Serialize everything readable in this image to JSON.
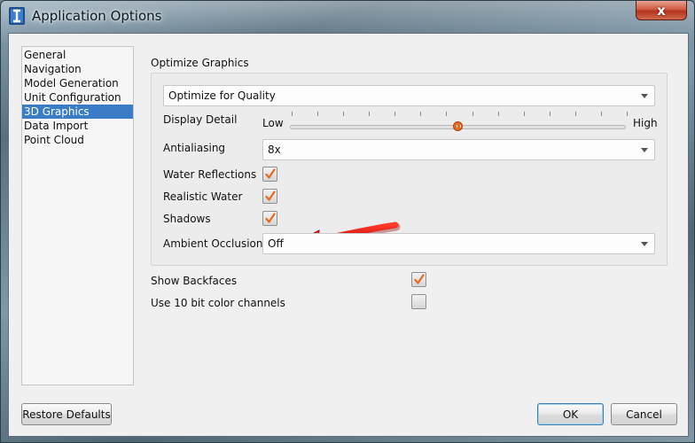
{
  "window": {
    "title": "Application Options",
    "close_glyph": "x"
  },
  "nav": {
    "items": [
      {
        "label": "General",
        "selected": false
      },
      {
        "label": "Navigation",
        "selected": false
      },
      {
        "label": "Model Generation",
        "selected": false
      },
      {
        "label": "Unit Configuration",
        "selected": false
      },
      {
        "label": "3D Graphics",
        "selected": true
      },
      {
        "label": "Data Import",
        "selected": false
      },
      {
        "label": "Point Cloud",
        "selected": false
      }
    ]
  },
  "graphics": {
    "section_label": "Optimize Graphics",
    "optimize_value": "Optimize for Quality",
    "display_detail": {
      "label": "Display Detail",
      "low_label": "Low",
      "high_label": "High",
      "level": 0.5
    },
    "antialiasing": {
      "label": "Antialiasing",
      "value": "8x"
    },
    "water_reflections": {
      "label": "Water Reflections",
      "checked": true
    },
    "realistic_water": {
      "label": "Realistic Water",
      "checked": true
    },
    "shadows": {
      "label": "Shadows",
      "checked": true
    },
    "ambient_occlusion": {
      "label": "Ambient Occlusion",
      "value": "Off"
    }
  },
  "options": {
    "show_backfaces": {
      "label": "Show Backfaces",
      "checked": true
    },
    "ten_bit_color": {
      "label": "Use 10 bit color channels",
      "checked": false
    }
  },
  "buttons": {
    "restore_defaults": "Restore Defaults",
    "ok": "OK",
    "cancel": "Cancel"
  },
  "colors": {
    "selection": "#3a7cc6",
    "accent_orange": "#e86a1e",
    "annotation_arrow": "#e01010"
  },
  "icons": {
    "app": "app-logo-icon",
    "close": "close-icon",
    "dropdown": "chevron-down-icon",
    "check": "checkmark-icon",
    "annotation": "red-arrow-icon"
  }
}
